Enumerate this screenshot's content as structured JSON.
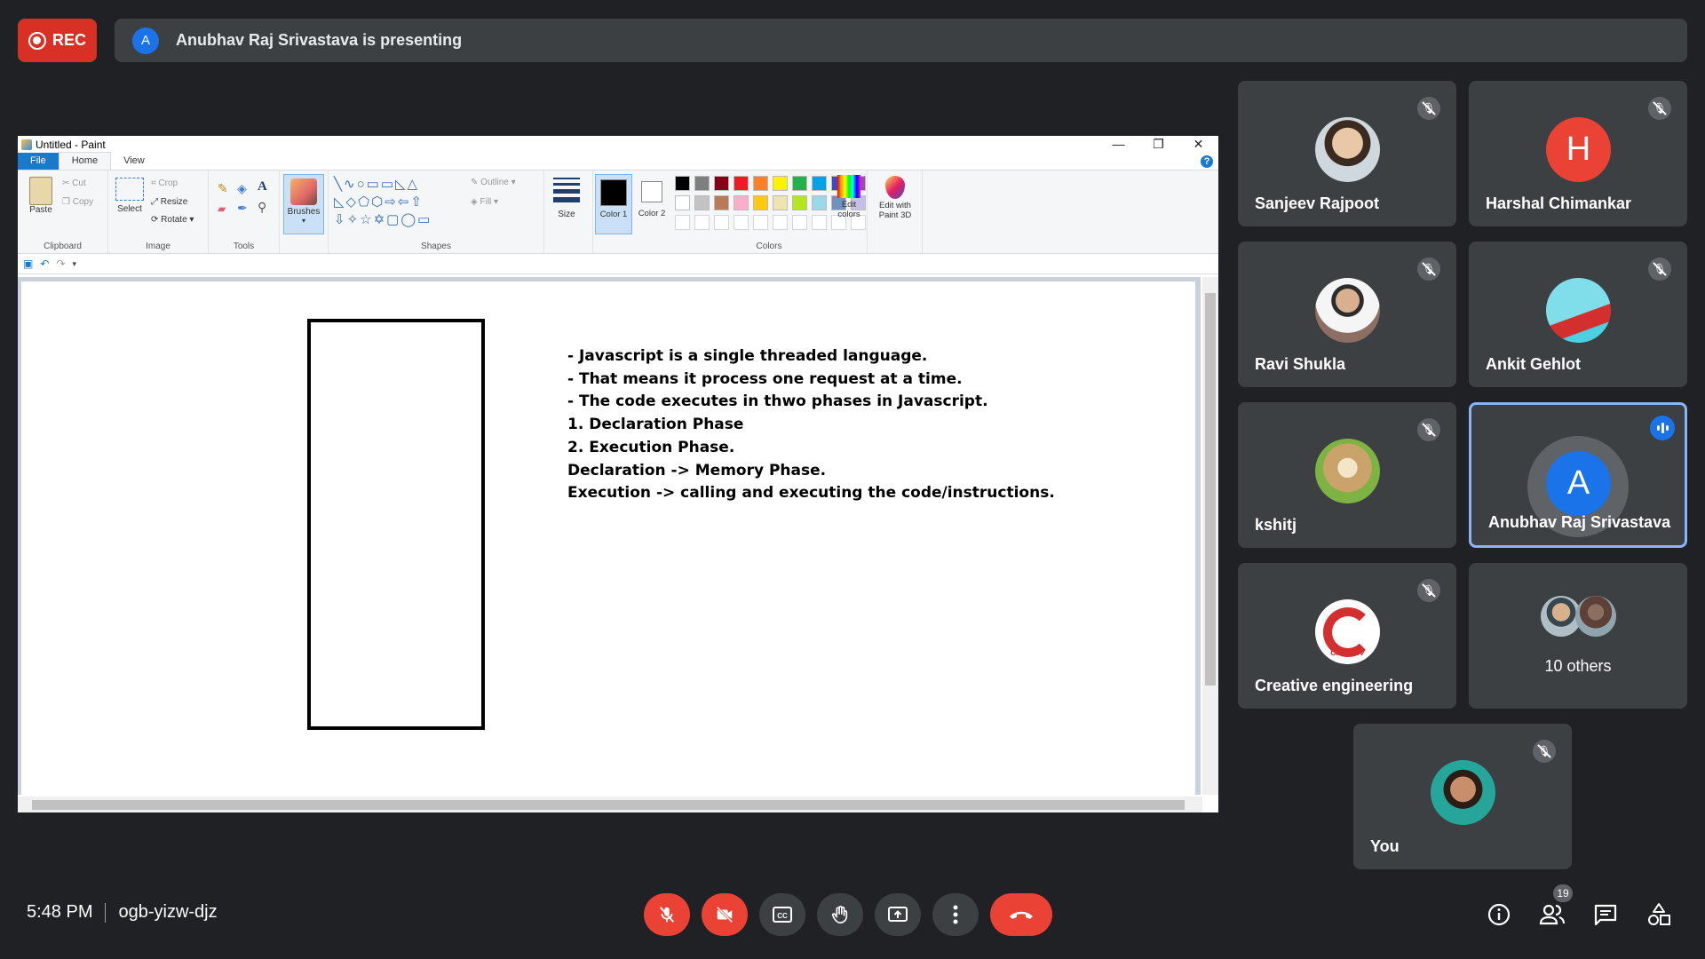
{
  "recording": {
    "label": "REC"
  },
  "presenting": {
    "avatar_letter": "A",
    "text": "Anubhav Raj Srivastava is presenting"
  },
  "paint": {
    "title": "Untitled - Paint",
    "window_controls": [
      "—",
      "❐",
      "✕"
    ],
    "tabs": [
      "File",
      "Home",
      "View"
    ],
    "help": "?",
    "ribbon": {
      "clipboard": {
        "label": "Clipboard",
        "paste": "Paste",
        "cut": "Cut",
        "copy": "Copy"
      },
      "image": {
        "label": "Image",
        "select": "Select",
        "crop": "Crop",
        "resize": "Resize",
        "rotate": "Rotate"
      },
      "tools": {
        "label": "Tools"
      },
      "brushes": "Brushes",
      "shapes": {
        "label": "Shapes",
        "outline": "Outline",
        "fill": "Fill"
      },
      "size": "Size",
      "color1": "Color 1",
      "color2": "Color 2",
      "colors": {
        "label": "Colors",
        "edit": "Edit colors"
      },
      "paint3d": "Edit with Paint 3D"
    },
    "palette_row1": [
      "#000000",
      "#7f7f7f",
      "#880015",
      "#ed1c24",
      "#ff7f27",
      "#fff200",
      "#22b14c",
      "#00a2e8",
      "#3f48cc",
      "#a349a4"
    ],
    "palette_row2": [
      "#ffffff",
      "#c3c3c3",
      "#b97a57",
      "#ffaec9",
      "#ffc90e",
      "#efe4b0",
      "#b5e61d",
      "#99d9ea",
      "#7092be",
      "#c8bfe7"
    ],
    "canvas_lines": [
      "- Javascript is a single threaded language.",
      "- That means it process one request at a time.",
      "- The code executes in thwo phases in Javascript.",
      "1. Declaration Phase",
      "2. Execution Phase.",
      "Declaration -> Memory Phase.",
      "Execution -> calling and executing the code/instructions."
    ]
  },
  "participants": [
    {
      "name": "Sanjeev Rajpoot",
      "avatar": "photo",
      "muted": true
    },
    {
      "name": "Harshal Chimankar",
      "avatar_letter": "H",
      "avatar_color": "#ea4335",
      "muted": true
    },
    {
      "name": "Ravi Shukla",
      "avatar": "photo",
      "muted": true
    },
    {
      "name": "Ankit Gehlot",
      "avatar": "photo",
      "muted": true
    },
    {
      "name": "kshitj",
      "avatar": "photo",
      "muted": true
    },
    {
      "name": "Anubhav Raj Srivastava",
      "avatar_letter": "A",
      "avatar_color": "#1a73e8",
      "speaking": true
    },
    {
      "name": "Creative engineering",
      "avatar": "logo",
      "avatar_text": "CREATIV",
      "muted": true
    },
    {
      "name": "10 others"
    },
    {
      "name": "You",
      "avatar": "photo",
      "muted": true
    }
  ],
  "meeting": {
    "time": "5:48 PM",
    "code": "ogb-yizw-djz",
    "participant_count": "19"
  },
  "colors": {
    "background": "#202124",
    "tile": "#3c4043",
    "danger": "#ea4335",
    "accent": "#1a73e8"
  }
}
